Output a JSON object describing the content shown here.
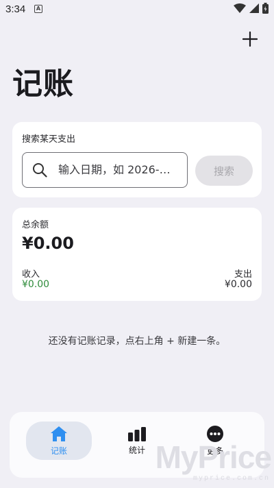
{
  "status": {
    "time": "3:34",
    "notif_icon": "A"
  },
  "header": {
    "title": "记账",
    "add_icon": "plus-icon"
  },
  "search": {
    "label": "搜索某天支出",
    "placeholder": "输入日期，如 2026-…",
    "button": "搜索"
  },
  "balance": {
    "label": "总余额",
    "value": "¥0.00",
    "income_label": "收入",
    "income_value": "¥0.00",
    "expense_label": "支出",
    "expense_value": "¥0.00"
  },
  "empty": {
    "text": "还没有记账记录，点右上角 + 新建一条。"
  },
  "nav": {
    "items": [
      {
        "label": "记账",
        "icon": "home-icon",
        "active": true
      },
      {
        "label": "统计",
        "icon": "bar-chart-icon",
        "active": false
      },
      {
        "label": "更多",
        "icon": "more-icon",
        "active": false
      }
    ]
  },
  "colors": {
    "accent": "#2f8ff0",
    "income": "#2e8b3a",
    "background": "#f0eff5"
  },
  "watermark": {
    "big": "MyPrice",
    "small": "myprice.com.cn"
  }
}
